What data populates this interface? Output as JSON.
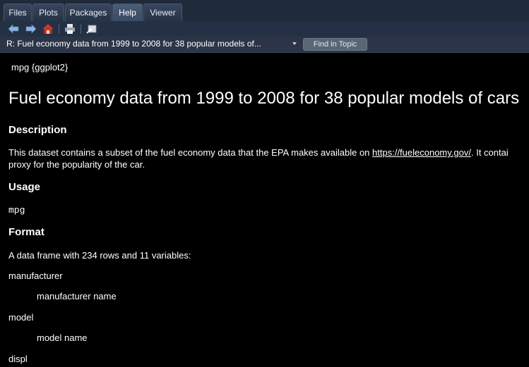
{
  "tabs": [
    {
      "label": "Files"
    },
    {
      "label": "Plots"
    },
    {
      "label": "Packages"
    },
    {
      "label": "Help",
      "active": true
    },
    {
      "label": "Viewer"
    }
  ],
  "toolbar": {
    "icons": [
      "back-arrow-icon",
      "forward-arrow-icon",
      "home-icon",
      "print-icon",
      "open-in-window-icon"
    ]
  },
  "topic": {
    "title": "R: Fuel economy data from 1999 to 2008 for 38 popular models of...",
    "find_label": "Find in Topic"
  },
  "doc": {
    "package_line": "mpg {ggplot2}",
    "title": "Fuel economy data from 1999 to 2008 for 38 popular models of cars",
    "description_heading": "Description",
    "description_text_before": "This dataset contains a subset of the fuel economy data that the EPA makes available on ",
    "description_link": "https://fueleconomy.gov/",
    "description_text_after": ". It contai",
    "description_line2": "proxy for the popularity of the car.",
    "usage_heading": "Usage",
    "usage_code": "mpg",
    "format_heading": "Format",
    "format_text": "A data frame with 234 rows and 11 variables:",
    "variables": [
      {
        "term": "manufacturer",
        "def": "manufacturer name"
      },
      {
        "term": "model",
        "def": "model name"
      },
      {
        "term": "displ",
        "def": ""
      }
    ]
  },
  "colors": {
    "background": "#000000",
    "panel": "#1f2a3a",
    "text": "#ffffff",
    "home_icon_red": "#c0392b"
  }
}
